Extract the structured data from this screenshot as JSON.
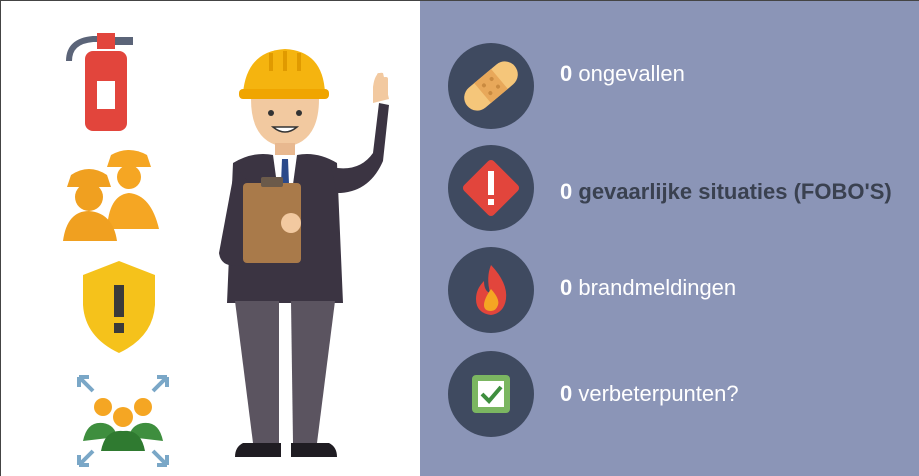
{
  "stats": [
    {
      "count": "0",
      "label": "ongevallen",
      "icon": "bandage-icon",
      "bold": false
    },
    {
      "count": "0",
      "label": "gevaarlijke situaties (FOBO'S)",
      "icon": "warning-diamond-icon",
      "bold": true
    },
    {
      "count": "0",
      "label": "brandmeldingen",
      "icon": "fire-icon",
      "bold": false
    },
    {
      "count": "0",
      "label": "verbeterpunten?",
      "icon": "checkbox-icon",
      "bold": false
    }
  ],
  "left_icons": [
    "fire-extinguisher-icon",
    "workers-hardhat-icon",
    "warning-shield-icon",
    "team-focus-icon"
  ],
  "colors": {
    "panel": "#8b95b7",
    "circle": "#3f4a60",
    "accent": "#f5a623"
  }
}
